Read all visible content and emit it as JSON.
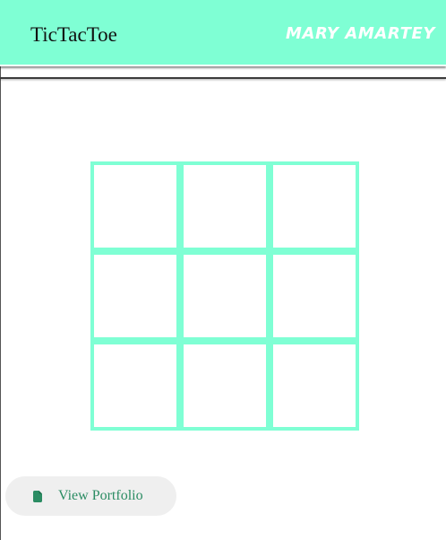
{
  "header": {
    "title": "TicTacToe",
    "author": "MARY AMARTEY",
    "background_color": "#7fffd4"
  },
  "board": {
    "rows": 3,
    "columns": 3,
    "grid_color": "#7fffd4",
    "cells": [
      "",
      "",
      "",
      "",
      "",
      "",
      "",
      "",
      ""
    ]
  },
  "footer": {
    "portfolio_button": {
      "label": "View Portfolio",
      "icon": "file-icon",
      "text_color": "#2b8c63"
    }
  }
}
